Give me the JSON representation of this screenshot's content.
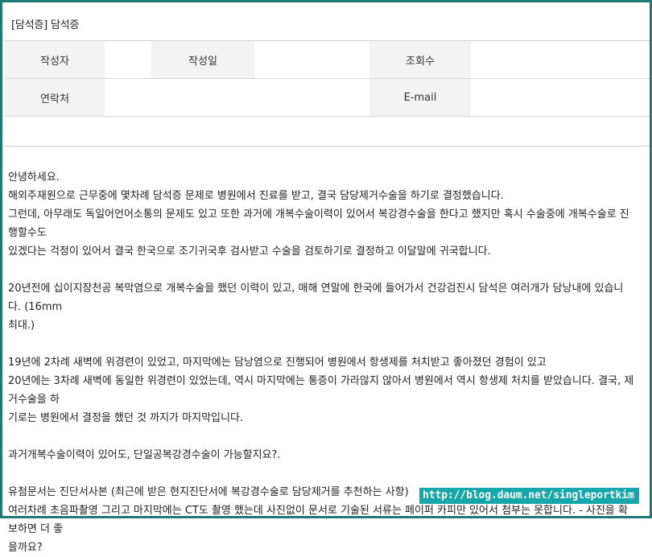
{
  "post": {
    "title": "[담석증] 담석증"
  },
  "meta": {
    "author_label": "작성자",
    "author_value": "",
    "date_label": "작성일",
    "date_value": "",
    "views_label": "조회수",
    "views_value": "",
    "contact_label": "연락처",
    "contact_value": "",
    "email_label": "E-mail",
    "email_value": ""
  },
  "content": {
    "lines": [
      "안녕하세요.",
      "해외주재원으로 근무중에 몇차례 담석증 문제로 병원에서 진료를 받고, 결국 담당제거수술을 하기로 결정했습니다.",
      "그런데, 아무래도 독일어언어소통의 문제도 있고 또한 과거에 개복수술이력이 있어서 복강경수술을 한다고 했지만 혹시 수술중에 개복수술로 진행할수도",
      "있겠다는 걱정이 있어서 결국 한국으로 조기귀국후 검사받고 수술을 검토하기로 결정하고 이달말에 귀국합니다.",
      "",
      "20년전에 십이지장천공 복막염으로 개복수술을 했던 이력이 있고, 매해 연말에 한국에 들어가서 건강검진시 담석은 여러개가 담낭내에 있습니다. (16mm",
      "최대.)",
      "",
      "19년에 2차례 새벽에 위경련이 있었고, 마지막에는 담낭염으로 진행되어 병원에서 항생제를 처치받고 좋아졌던 경험이 있고",
      "20년에는 3차례 새벽에 동일한 위경련이 있었는데, 역시 마지막에는 통증이 가라않지 않아서 병원에서 역시 항생제 처치를 받았습니다. 결국, 제거수술을 하",
      "기로는 병원에서 결정을 했던 것 까지가 마지막입니다.",
      "",
      "과거개복수술이력이 있어도, 단일공복강경수술이 가능할지요?.",
      "",
      "유첨문서는 진단서사본 (최근에 받은 현지진단서에 복강경수술로 담당제거를 추천하는 사항)",
      "여러차례 초음파촬영 그리고 마지막에는 CT도 촬영 했는데 사진없이 문서로 기술된 서류는 페이퍼 카피만 있어서 첨부는 못합니다. - 사진을 확보하면 더 좋",
      "을까요?"
    ]
  },
  "watermark": {
    "text": "http://blog.daum.net/singleportkim"
  },
  "colors": {
    "frame_border": "#1e7a73",
    "label_bg": "#f3f3f3",
    "watermark_bg": "#15a7a9"
  }
}
